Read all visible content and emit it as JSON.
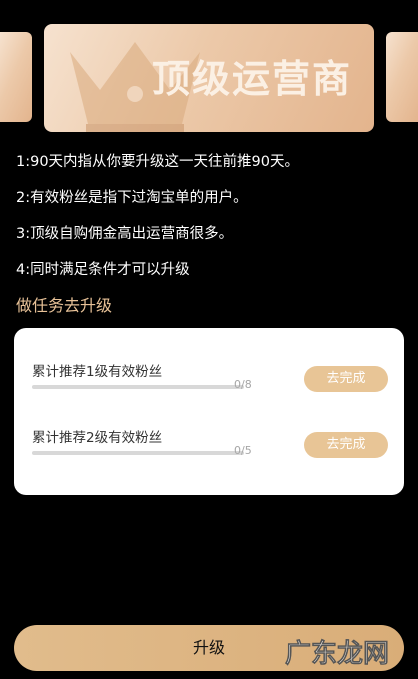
{
  "banner": {
    "title": "顶级运营商",
    "icon": "crown-icon"
  },
  "rules": [
    "1:90天内指从你要升级这一天往前推90天。",
    "2:有效粉丝是指下过淘宝单的用户。",
    "3:顶级自购佣金高出运营商很多。",
    "4:同时满足条件才可以升级"
  ],
  "tasks_title": "做任务去升级",
  "tasks": [
    {
      "label": "累计推荐1级有效粉丝",
      "count": "0/8",
      "progress": 0,
      "button": "去完成"
    },
    {
      "label": "累计推荐2级有效粉丝",
      "count": "0/5",
      "progress": 0,
      "button": "去完成"
    }
  ],
  "upgrade_button": "升级",
  "watermark": "广东龙网",
  "colors": {
    "background": "#000000",
    "accent_gold": "#e8c596",
    "section_title": "#e8c298",
    "banner_light": "#f6e2cf",
    "banner_dark": "#e3b48d"
  }
}
